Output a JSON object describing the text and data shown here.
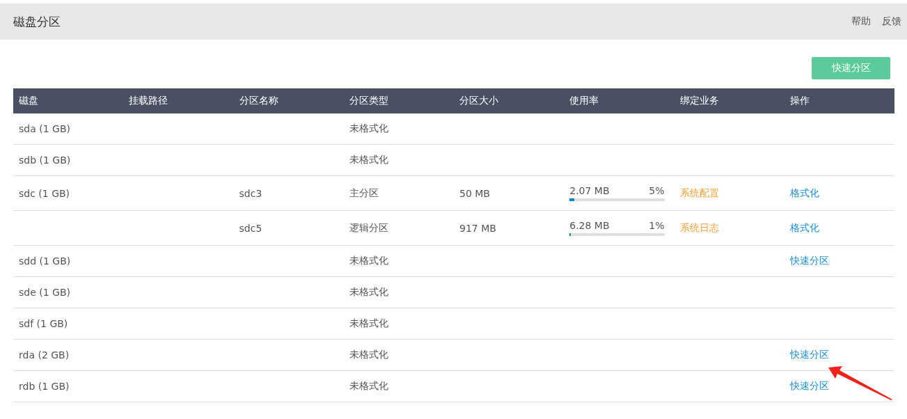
{
  "header": {
    "title": "磁盘分区",
    "links": [
      "帮助",
      "反馈"
    ]
  },
  "toolbar": {
    "button": "快速分区"
  },
  "table": {
    "columns": [
      "磁盘",
      "挂载路径",
      "分区名称",
      "分区类型",
      "分区大小",
      "使用率",
      "绑定业务",
      "操作"
    ],
    "rows": [
      {
        "disk": "sda (1 GB)",
        "type": "未格式化"
      },
      {
        "disk": "sdb (1 GB)",
        "type": "未格式化"
      },
      {
        "disk": "sdc (1 GB)",
        "partition": "sdc3",
        "type": "主分区",
        "size": "50 MB",
        "usage": {
          "used": "2.07 MB",
          "percent": "5%",
          "level": 0.05
        },
        "binding": "系统配置",
        "action": "格式化"
      },
      {
        "partition": "sdc5",
        "type": "逻辑分区",
        "size": "917 MB",
        "usage": {
          "used": "6.28 MB",
          "percent": "1%",
          "level": 0.01
        },
        "binding": "系统日志",
        "action": "格式化"
      },
      {
        "disk": "sdd (1 GB)",
        "type": "未格式化",
        "action": "快速分区"
      },
      {
        "disk": "sde (1 GB)",
        "type": "未格式化"
      },
      {
        "disk": "sdf (1 GB)",
        "type": "未格式化"
      },
      {
        "disk": "rda (2 GB)",
        "type": "未格式化",
        "action": "快速分区"
      },
      {
        "disk": "rdb (1 GB)",
        "type": "未格式化",
        "action": "快速分区"
      }
    ]
  }
}
